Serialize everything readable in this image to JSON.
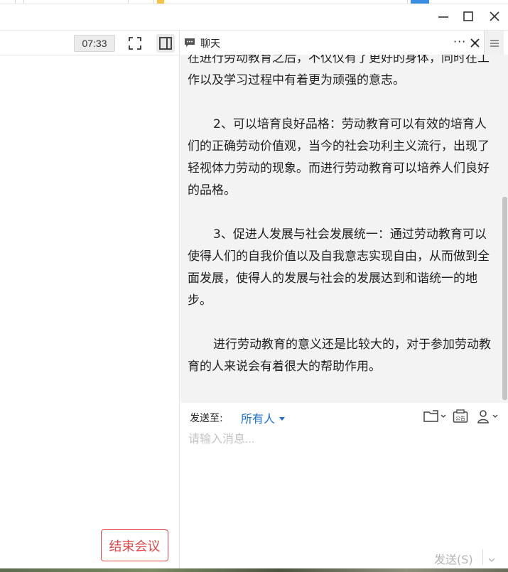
{
  "meeting": {
    "timer": "07:33",
    "end_button": "结束会议"
  },
  "chat": {
    "title": "聊天",
    "more": "···",
    "messages": [
      "在进行劳动教育之后，不仅仅有了更好的身体，同时在工作以及学习过程中有着更为顽强的意志。",
      "2、可以培育良好品格：劳动教育可以有效的培育人们的正确劳动价值观，当今的社会功利主义流行，出现了轻视体力劳动的现象。而进行劳动教育可以培养人们良好的品格。",
      "3、促进人发展与社会发展统一：通过劳动教育可以使得人们的自我价值以及自我意志实现自由，从而做到全面发展，使得人的发展与社会的发展达到和谐统一的地步。",
      "进行劳动教育的意义还是比较大的，对于参加劳动教育的人来说会有着很大的帮助作用。"
    ],
    "send_to_label": "发送至:",
    "recipient": "所有人",
    "notice_icon_text": "公告",
    "input_placeholder": "请输入消息...",
    "send_button": "发送(S)"
  },
  "colors": {
    "accent_blue": "#1a6fd6",
    "end_red": "#e04848",
    "chat_bg": "#f3f3f3"
  },
  "icons": [
    "minimize-icon",
    "maximize-icon",
    "close-icon",
    "fullscreen-icon",
    "sidebar-toggle-icon",
    "chat-bubble-icon",
    "menu-icon",
    "folder-icon",
    "notice-icon",
    "person-icon",
    "chevron-down-icon"
  ]
}
